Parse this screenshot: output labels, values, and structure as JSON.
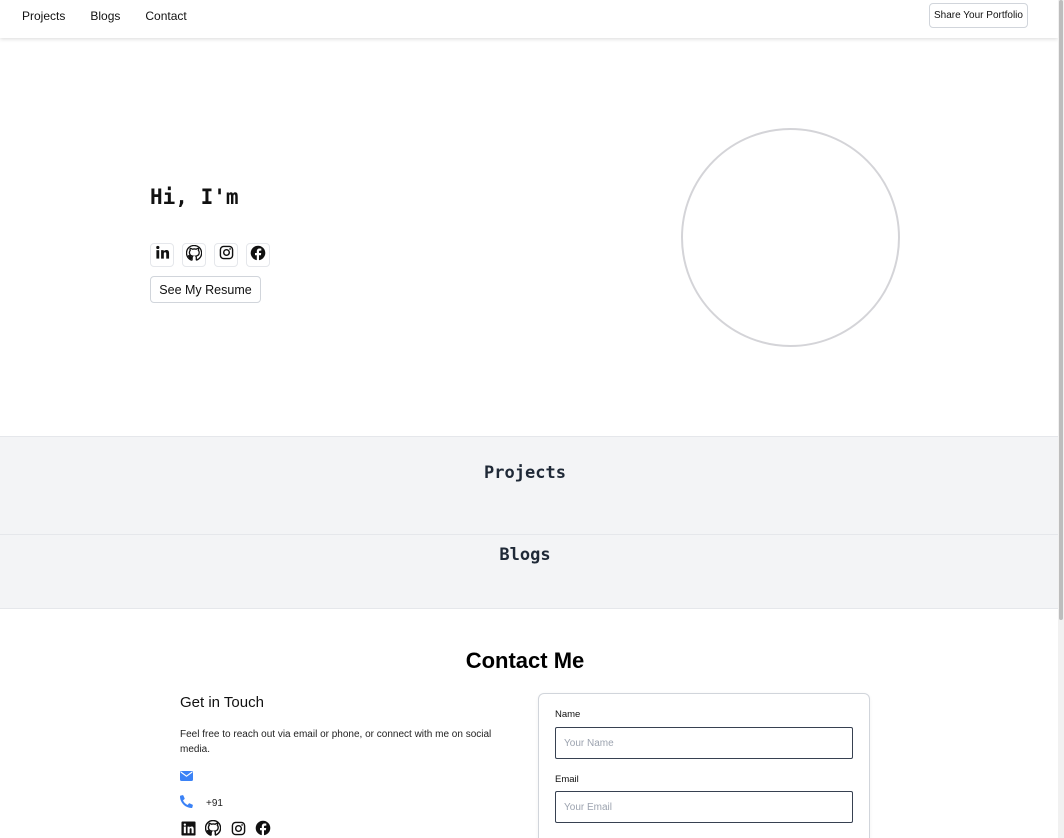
{
  "nav": {
    "links": [
      "Projects",
      "Blogs",
      "Contact"
    ],
    "share_label": "Share Your Portfolio"
  },
  "hero": {
    "greeting": "Hi, I'm",
    "social_icons": [
      "linkedin-icon",
      "github-icon",
      "instagram-icon",
      "facebook-icon"
    ],
    "resume_label": "See My Resume"
  },
  "sections": {
    "projects_title": "Projects",
    "blogs_title": "Blogs"
  },
  "contact": {
    "title": "Contact Me",
    "get_in_touch": "Get in Touch",
    "description": "Feel free to reach out via email or phone, or connect with me on social media.",
    "phone": "+91",
    "icon_color": "#3b82f6",
    "form": {
      "name_label": "Name",
      "name_placeholder": "Your Name",
      "email_label": "Email",
      "email_placeholder": "Your Email"
    }
  }
}
